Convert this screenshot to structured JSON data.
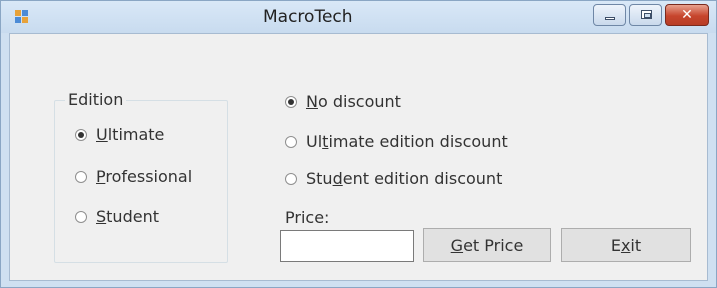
{
  "window": {
    "title": "MacroTech"
  },
  "caption_buttons": {
    "minimize": "minimize-icon",
    "maximize": "maximize-icon",
    "close": "close-icon"
  },
  "edition_group": {
    "legend": "Edition",
    "options": [
      {
        "before": "",
        "mnemonic": "U",
        "after": "ltimate",
        "checked": true
      },
      {
        "before": "",
        "mnemonic": "P",
        "after": "rofessional",
        "checked": false
      },
      {
        "before": "",
        "mnemonic": "S",
        "after": "tudent",
        "checked": false
      }
    ]
  },
  "discount_options": [
    {
      "before": "",
      "mnemonic": "N",
      "after": "o discount",
      "checked": true
    },
    {
      "before": "Ul",
      "mnemonic": "t",
      "after": "imate edition discount",
      "checked": false
    },
    {
      "before": "Stu",
      "mnemonic": "d",
      "after": "ent edition discount",
      "checked": false
    }
  ],
  "price": {
    "label": "Price:",
    "value": ""
  },
  "buttons": {
    "get_price": {
      "before": "",
      "mnemonic": "G",
      "after": "et Price"
    },
    "exit": {
      "before": "E",
      "mnemonic": "x",
      "after": "it"
    }
  },
  "colors": {
    "title_bar": "#c8dbef",
    "close_button": "#c6452d",
    "client": "#f0f0f0"
  }
}
